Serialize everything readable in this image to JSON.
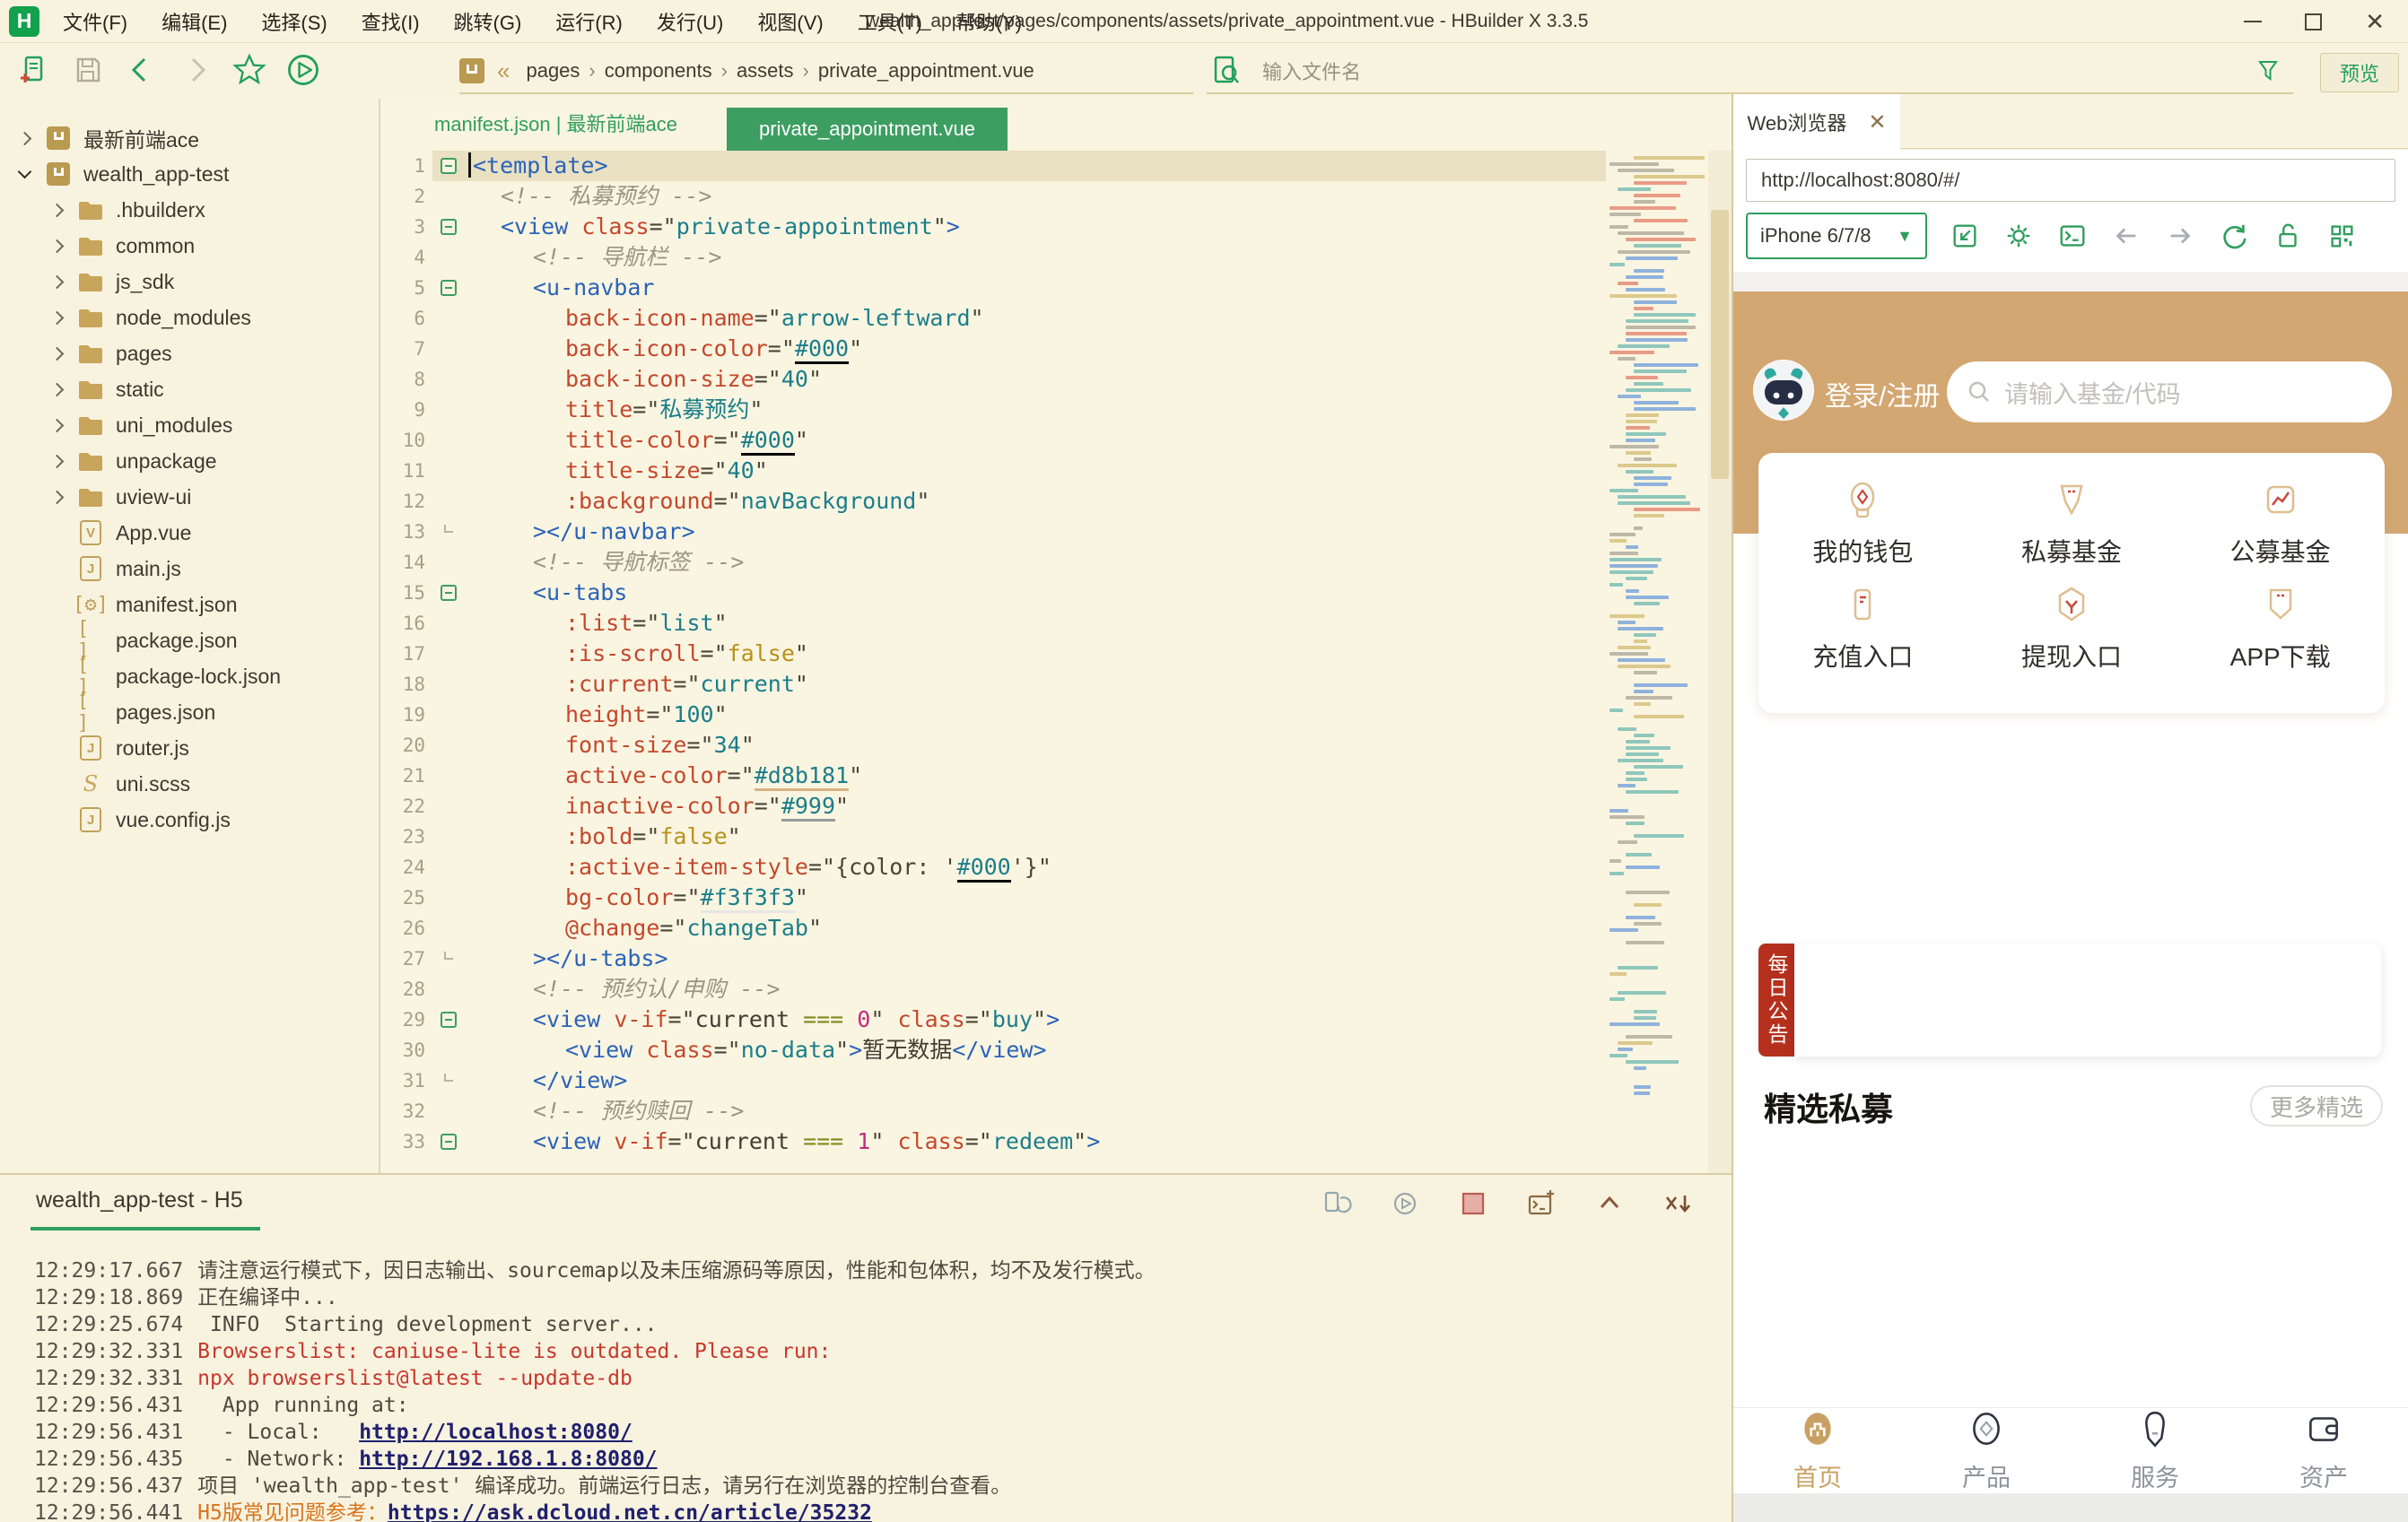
{
  "window": {
    "title": "wealth_app-test/pages/components/assets/private_appointment.vue - HBuilder X 3.3.5",
    "menus": [
      "文件(F)",
      "编辑(E)",
      "选择(S)",
      "查找(I)",
      "跳转(G)",
      "运行(R)",
      "发行(U)",
      "视图(V)",
      "工具(T)",
      "帮助(Y)"
    ]
  },
  "toolbar": {
    "breadcrumb": [
      "pages",
      "components",
      "assets",
      "private_appointment.vue"
    ],
    "search_placeholder": "输入文件名",
    "preview_label": "预览"
  },
  "sidebar": {
    "items": [
      {
        "depth": 0,
        "arrow": "right",
        "icon": "project",
        "label": "最新前端ace"
      },
      {
        "depth": 0,
        "arrow": "down",
        "icon": "project",
        "label": "wealth_app-test"
      },
      {
        "depth": 1,
        "arrow": "right",
        "icon": "folder",
        "label": ".hbuilderx"
      },
      {
        "depth": 1,
        "arrow": "right",
        "icon": "folder",
        "label": "common"
      },
      {
        "depth": 1,
        "arrow": "right",
        "icon": "folder",
        "label": "js_sdk"
      },
      {
        "depth": 1,
        "arrow": "right",
        "icon": "folder",
        "label": "node_modules"
      },
      {
        "depth": 1,
        "arrow": "right",
        "icon": "folder",
        "label": "pages"
      },
      {
        "depth": 1,
        "arrow": "right",
        "icon": "folder",
        "label": "static"
      },
      {
        "depth": 1,
        "arrow": "right",
        "icon": "folder",
        "label": "uni_modules"
      },
      {
        "depth": 1,
        "arrow": "right",
        "icon": "folder",
        "label": "unpackage"
      },
      {
        "depth": 1,
        "arrow": "right",
        "icon": "folder",
        "label": "uview-ui"
      },
      {
        "depth": 1,
        "arrow": "",
        "icon": "vue",
        "label": "App.vue"
      },
      {
        "depth": 1,
        "arrow": "",
        "icon": "js",
        "label": "main.js"
      },
      {
        "depth": 1,
        "arrow": "",
        "icon": "manifest",
        "label": "manifest.json"
      },
      {
        "depth": 1,
        "arrow": "",
        "icon": "json",
        "label": "package.json"
      },
      {
        "depth": 1,
        "arrow": "",
        "icon": "json",
        "label": "package-lock.json"
      },
      {
        "depth": 1,
        "arrow": "",
        "icon": "json",
        "label": "pages.json"
      },
      {
        "depth": 1,
        "arrow": "",
        "icon": "js",
        "label": "router.js"
      },
      {
        "depth": 1,
        "arrow": "",
        "icon": "scss",
        "label": "uni.scss"
      },
      {
        "depth": 1,
        "arrow": "",
        "icon": "js",
        "label": "vue.config.js"
      }
    ]
  },
  "editor": {
    "tab_inactive": "manifest.json | 最新前端ace",
    "tab_active": "private_appointment.vue",
    "lines": [
      {
        "n": 1,
        "i": 0,
        "f": "open",
        "cur": true,
        "s": [
          [
            "t",
            "<template>"
          ]
        ]
      },
      {
        "n": 2,
        "i": 1,
        "s": [
          [
            "c",
            "<!-- 私募预约 -->"
          ]
        ]
      },
      {
        "n": 3,
        "i": 1,
        "f": "open",
        "s": [
          [
            "t",
            "<view"
          ],
          [
            "x",
            " "
          ],
          [
            "a",
            "class"
          ],
          [
            "p",
            "=\""
          ],
          [
            "v",
            "private-appointment"
          ],
          [
            "p",
            "\""
          ],
          [
            "t",
            ">"
          ]
        ]
      },
      {
        "n": 4,
        "i": 2,
        "s": [
          [
            "c",
            "<!-- 导航栏 -->"
          ]
        ]
      },
      {
        "n": 5,
        "i": 2,
        "f": "open",
        "s": [
          [
            "t",
            "<u-navbar"
          ]
        ]
      },
      {
        "n": 6,
        "i": 3,
        "s": [
          [
            "a",
            "back-icon-name"
          ],
          [
            "p",
            "=\""
          ],
          [
            "v",
            "arrow-leftward"
          ],
          [
            "p",
            "\""
          ]
        ]
      },
      {
        "n": 7,
        "i": 3,
        "s": [
          [
            "a",
            "back-icon-color"
          ],
          [
            "p",
            "=\""
          ],
          [
            "v",
            "#000",
            "#000000"
          ],
          [
            "p",
            "\""
          ]
        ]
      },
      {
        "n": 8,
        "i": 3,
        "s": [
          [
            "a",
            "back-icon-size"
          ],
          [
            "p",
            "=\""
          ],
          [
            "v",
            "40"
          ],
          [
            "p",
            "\""
          ]
        ]
      },
      {
        "n": 9,
        "i": 3,
        "s": [
          [
            "a",
            "title"
          ],
          [
            "p",
            "=\""
          ],
          [
            "v",
            "私募预约"
          ],
          [
            "p",
            "\""
          ]
        ]
      },
      {
        "n": 10,
        "i": 3,
        "s": [
          [
            "a",
            "title-color"
          ],
          [
            "p",
            "=\""
          ],
          [
            "v",
            "#000",
            "#000000"
          ],
          [
            "p",
            "\""
          ]
        ]
      },
      {
        "n": 11,
        "i": 3,
        "s": [
          [
            "a",
            "title-size"
          ],
          [
            "p",
            "=\""
          ],
          [
            "v",
            "40"
          ],
          [
            "p",
            "\""
          ]
        ]
      },
      {
        "n": 12,
        "i": 3,
        "s": [
          [
            "a",
            ":background"
          ],
          [
            "p",
            "=\""
          ],
          [
            "v",
            "navBackground"
          ],
          [
            "p",
            "\""
          ]
        ]
      },
      {
        "n": 13,
        "i": 2,
        "f": "end",
        "s": [
          [
            "t",
            "></u-navbar>"
          ]
        ]
      },
      {
        "n": 14,
        "i": 2,
        "s": [
          [
            "c",
            "<!-- 导航标签 -->"
          ]
        ]
      },
      {
        "n": 15,
        "i": 2,
        "f": "open",
        "s": [
          [
            "t",
            "<u-tabs"
          ]
        ]
      },
      {
        "n": 16,
        "i": 3,
        "s": [
          [
            "a",
            ":list"
          ],
          [
            "p",
            "=\""
          ],
          [
            "v",
            "list"
          ],
          [
            "p",
            "\""
          ]
        ]
      },
      {
        "n": 17,
        "i": 3,
        "s": [
          [
            "a",
            ":is-scroll"
          ],
          [
            "p",
            "=\""
          ],
          [
            "k",
            "false"
          ],
          [
            "p",
            "\""
          ]
        ]
      },
      {
        "n": 18,
        "i": 3,
        "s": [
          [
            "a",
            ":current"
          ],
          [
            "p",
            "=\""
          ],
          [
            "v",
            "current"
          ],
          [
            "p",
            "\""
          ]
        ]
      },
      {
        "n": 19,
        "i": 3,
        "s": [
          [
            "a",
            "height"
          ],
          [
            "p",
            "=\""
          ],
          [
            "v",
            "100"
          ],
          [
            "p",
            "\""
          ]
        ]
      },
      {
        "n": 20,
        "i": 3,
        "s": [
          [
            "a",
            "font-size"
          ],
          [
            "p",
            "=\""
          ],
          [
            "v",
            "34"
          ],
          [
            "p",
            "\""
          ]
        ]
      },
      {
        "n": 21,
        "i": 3,
        "s": [
          [
            "a",
            "active-color"
          ],
          [
            "p",
            "=\""
          ],
          [
            "v",
            "#d8b181",
            "#d8b181"
          ],
          [
            "p",
            "\""
          ]
        ]
      },
      {
        "n": 22,
        "i": 3,
        "s": [
          [
            "a",
            "inactive-color"
          ],
          [
            "p",
            "=\""
          ],
          [
            "v",
            "#999",
            "#999999"
          ],
          [
            "p",
            "\""
          ]
        ]
      },
      {
        "n": 23,
        "i": 3,
        "s": [
          [
            "a",
            ":bold"
          ],
          [
            "p",
            "=\""
          ],
          [
            "k",
            "false"
          ],
          [
            "p",
            "\""
          ]
        ]
      },
      {
        "n": 24,
        "i": 3,
        "s": [
          [
            "a",
            ":active-item-style"
          ],
          [
            "p",
            "=\"{color: '"
          ],
          [
            "v",
            "#000",
            "#000000"
          ],
          [
            "p",
            "'}\""
          ]
        ]
      },
      {
        "n": 25,
        "i": 3,
        "s": [
          [
            "a",
            "bg-color"
          ],
          [
            "p",
            "=\""
          ],
          [
            "v",
            "#f3f3f3",
            "#e6e6e6"
          ],
          [
            "p",
            "\""
          ]
        ]
      },
      {
        "n": 26,
        "i": 3,
        "s": [
          [
            "a",
            "@change"
          ],
          [
            "p",
            "=\""
          ],
          [
            "v",
            "changeTab"
          ],
          [
            "p",
            "\""
          ]
        ]
      },
      {
        "n": 27,
        "i": 2,
        "f": "end",
        "s": [
          [
            "t",
            "></u-tabs>"
          ]
        ]
      },
      {
        "n": 28,
        "i": 2,
        "s": [
          [
            "c",
            "<!-- 预约认/申购 -->"
          ]
        ]
      },
      {
        "n": 29,
        "i": 2,
        "f": "open",
        "s": [
          [
            "t",
            "<view"
          ],
          [
            "x",
            " "
          ],
          [
            "a",
            "v-if"
          ],
          [
            "p",
            "=\""
          ],
          [
            "x",
            "current "
          ],
          [
            "o",
            "==="
          ],
          [
            "x",
            " "
          ],
          [
            "n",
            "0"
          ],
          [
            "p",
            "\" "
          ],
          [
            "a",
            "class"
          ],
          [
            "p",
            "=\""
          ],
          [
            "v",
            "buy"
          ],
          [
            "p",
            "\""
          ],
          [
            "t",
            ">"
          ]
        ]
      },
      {
        "n": 30,
        "i": 3,
        "s": [
          [
            "t",
            "<view"
          ],
          [
            "x",
            " "
          ],
          [
            "a",
            "class"
          ],
          [
            "p",
            "=\""
          ],
          [
            "v",
            "no-data"
          ],
          [
            "p",
            "\""
          ],
          [
            "t",
            ">"
          ],
          [
            "x",
            "暂无数据"
          ],
          [
            "t",
            "</view>"
          ]
        ]
      },
      {
        "n": 31,
        "i": 2,
        "f": "end",
        "s": [
          [
            "t",
            "</view>"
          ]
        ]
      },
      {
        "n": 32,
        "i": 2,
        "s": [
          [
            "c",
            "<!-- 预约赎回 -->"
          ]
        ]
      },
      {
        "n": 33,
        "i": 2,
        "f": "open",
        "s": [
          [
            "t",
            "<view"
          ],
          [
            "x",
            " "
          ],
          [
            "a",
            "v-if"
          ],
          [
            "p",
            "=\""
          ],
          [
            "x",
            "current "
          ],
          [
            "o",
            "==="
          ],
          [
            "x",
            " "
          ],
          [
            "n",
            "1"
          ],
          [
            "p",
            "\" "
          ],
          [
            "a",
            "class"
          ],
          [
            "p",
            "=\""
          ],
          [
            "v",
            "redeem"
          ],
          [
            "p",
            "\""
          ],
          [
            "t",
            ">"
          ]
        ]
      }
    ]
  },
  "browser": {
    "tab_label": "Web浏览器",
    "url": "http://localhost:8080/#/",
    "device": "iPhone 6/7/8"
  },
  "app": {
    "login_label": "登录/注册",
    "search_placeholder": "请输入基金/代码",
    "grid": [
      {
        "icon": "wallet",
        "label": "我的钱包"
      },
      {
        "icon": "private-fund",
        "label": "私募基金"
      },
      {
        "icon": "public-fund",
        "label": "公募基金"
      },
      {
        "icon": "recharge",
        "label": "充值入口"
      },
      {
        "icon": "withdraw",
        "label": "提现入口"
      },
      {
        "icon": "app-download",
        "label": "APP下载"
      }
    ],
    "notice_label": "每日公告",
    "section_title": "精选私募",
    "more_label": "更多精选",
    "nav": [
      {
        "icon": "home",
        "label": "首页",
        "active": true
      },
      {
        "icon": "product",
        "label": "产品",
        "active": false
      },
      {
        "icon": "service",
        "label": "服务",
        "active": false
      },
      {
        "icon": "assets",
        "label": "资产",
        "active": false
      }
    ]
  },
  "console": {
    "tab_label": "wealth_app-test - H5",
    "lines": [
      {
        "time": "12:29:17.667",
        "s": [
          [
            "g",
            "请注意运行模式下，因日志输出、sourcemap以及未压缩源码等原因，性能和包体积，均不及发行模式。"
          ]
        ]
      },
      {
        "time": "12:29:18.869",
        "s": [
          [
            "g",
            "正在编译中..."
          ]
        ]
      },
      {
        "time": "12:29:25.674",
        "s": [
          [
            "g",
            " INFO  Starting development server..."
          ]
        ]
      },
      {
        "time": "12:29:32.331",
        "s": [
          [
            "r",
            "Browserslist: caniuse-lite is outdated. Please run:"
          ]
        ]
      },
      {
        "time": "12:29:32.331",
        "s": [
          [
            "r",
            "npx browserslist@latest --update-db"
          ]
        ]
      },
      {
        "time": "12:29:56.431",
        "s": [
          [
            "g",
            "  App running at:"
          ]
        ]
      },
      {
        "time": "12:29:56.431",
        "s": [
          [
            "g",
            "  - Local:   "
          ],
          [
            "l",
            "http://localhost:8080/"
          ]
        ]
      },
      {
        "time": "12:29:56.435",
        "s": [
          [
            "g",
            "  - Network: "
          ],
          [
            "l",
            "http://192.168.1.8:8080/"
          ]
        ]
      },
      {
        "time": "12:29:56.437",
        "s": [
          [
            "g",
            "项目 'wealth_app-test' 编译成功。前端运行日志，请另行在浏览器的控制台查看。"
          ]
        ]
      },
      {
        "time": "12:29:56.441",
        "s": [
          [
            "o",
            "H5版常见问题参考："
          ],
          [
            "l",
            "https://ask.dcloud.net.cn/article/35232"
          ]
        ]
      }
    ]
  },
  "colors": {
    "accent_green": "#2F9E5D",
    "brand_gold": "#C9A063",
    "app_header_tan": "#D3A772",
    "notice_red": "#B5301C",
    "error_red": "#C8372D",
    "editor_active_color": "#d8b181"
  }
}
